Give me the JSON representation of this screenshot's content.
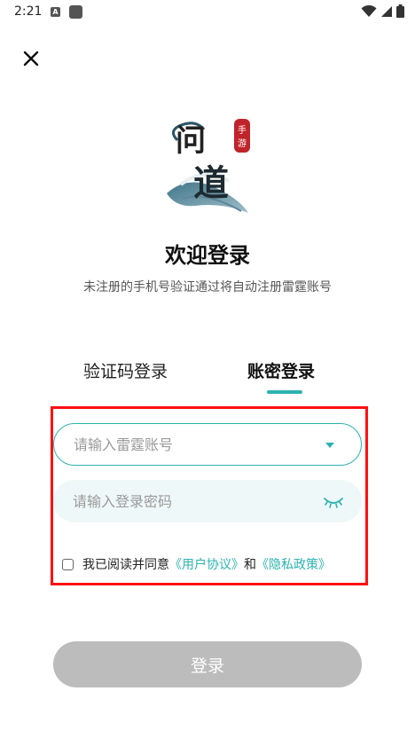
{
  "status_bar": {
    "time": "2:21",
    "notif_icon_letter": "A"
  },
  "header": {
    "close_icon": "close-icon"
  },
  "logo": {
    "main_text": "问道",
    "badge_text": "手游"
  },
  "welcome": {
    "title": "欢迎登录",
    "subtitle": "未注册的手机号验证通过将自动注册雷霆账号"
  },
  "tabs": [
    {
      "label": "验证码登录",
      "active": false
    },
    {
      "label": "账密登录",
      "active": true
    }
  ],
  "form": {
    "account_placeholder": "请输入雷霆账号",
    "account_value": "",
    "password_placeholder": "请输入登录密码",
    "password_value": ""
  },
  "agreement": {
    "prefix": "我已阅读并同意",
    "link1": "《用户协议》",
    "middle": "和",
    "link2": "《隐私政策》",
    "checked": false
  },
  "login_button": {
    "label": "登录"
  },
  "colors": {
    "accent": "#2bb3b0",
    "highlight": "#ff1010",
    "button_disabled": "#bcbcbc"
  }
}
